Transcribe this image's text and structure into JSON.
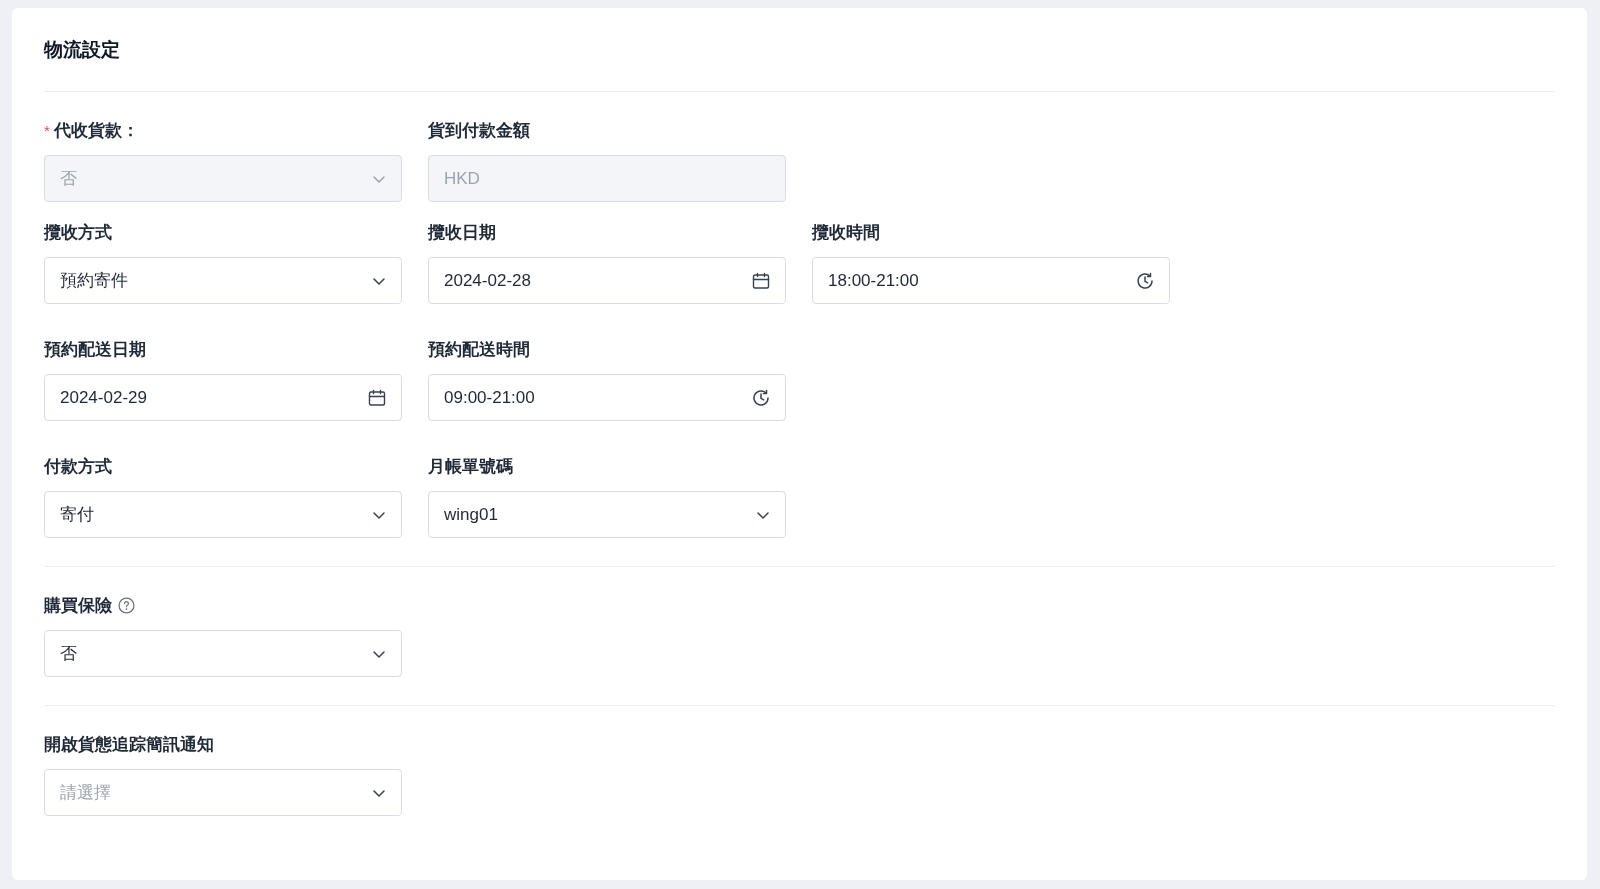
{
  "card": {
    "title": "物流設定"
  },
  "sections": [
    {
      "rows": [
        {
          "fields": [
            {
              "label": "代收貨款：",
              "required_mark": "*",
              "help": false,
              "kind": "select",
              "value": "否",
              "disabled": true
            },
            {
              "label": "貨到付款金額",
              "help": false,
              "kind": "input",
              "placeholder": "HKD",
              "disabled": true
            }
          ]
        },
        {
          "fields": [
            {
              "label": "攬收方式",
              "help": false,
              "kind": "select",
              "value": "預約寄件",
              "disabled": false
            },
            {
              "label": "攬收日期",
              "help": false,
              "kind": "date",
              "value": "2024-02-28",
              "disabled": false
            },
            {
              "label": "攬收時間",
              "help": false,
              "kind": "time",
              "value": "18:00-21:00",
              "disabled": false
            }
          ]
        },
        {
          "fields": [
            {
              "label": "預約配送日期",
              "help": false,
              "kind": "date",
              "value": "2024-02-29",
              "disabled": false
            },
            {
              "label": "預約配送時間",
              "help": false,
              "kind": "time",
              "value": "09:00-21:00",
              "disabled": false
            }
          ]
        },
        {
          "fields": [
            {
              "label": "付款方式",
              "help": false,
              "kind": "select",
              "value": "寄付",
              "disabled": false
            },
            {
              "label": "月帳單號碼",
              "help": false,
              "kind": "select",
              "value": "wing01",
              "disabled": false
            }
          ]
        }
      ]
    },
    {
      "rows": [
        {
          "fields": [
            {
              "label": "購買保險",
              "help": true,
              "kind": "select",
              "value": "否",
              "disabled": false
            }
          ]
        }
      ]
    },
    {
      "rows": [
        {
          "fields": [
            {
              "label": "開啟貨態追踪簡訊通知",
              "help": false,
              "kind": "select",
              "placeholder": "請選擇",
              "disabled": false
            }
          ]
        }
      ]
    }
  ]
}
